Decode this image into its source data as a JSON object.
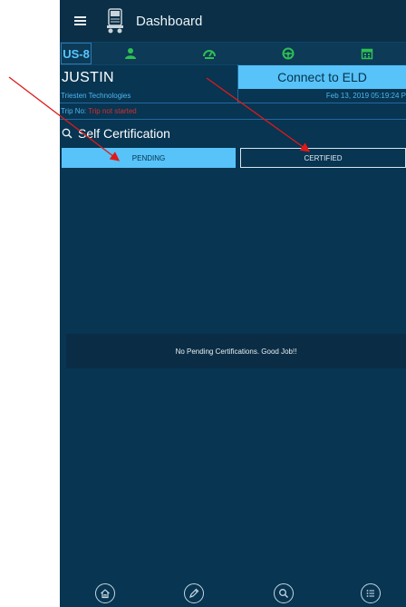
{
  "header": {
    "title": "Dashboard"
  },
  "status": {
    "code": "US-8"
  },
  "driver": {
    "name": "JUSTIN",
    "company": "Triesten Technologies",
    "connect_label": "Connect to ELD",
    "datetime": "Feb 13, 2019 05:19:24 P",
    "trip_label": "Trip No:",
    "trip_value": "Trip not started"
  },
  "section": {
    "title": "Self Certification"
  },
  "tabs": {
    "pending": "PENDING",
    "certified": "CERTIFIED"
  },
  "empty_message": "No Pending Certifications. Good Job!!",
  "colors": {
    "background": "#073552",
    "accent": "#57c3f8",
    "status_green": "#2fbe52",
    "annotation_arrow": "#e01919"
  },
  "icons": {
    "topbar": [
      "menu-icon",
      "truck-icon"
    ],
    "statusbar": [
      "driver-status-icon",
      "gauge-icon",
      "steering-wheel-icon",
      "calendar-icon"
    ],
    "bottomnav": [
      "home-icon",
      "pencil-icon",
      "search-icon",
      "list-icon"
    ]
  }
}
